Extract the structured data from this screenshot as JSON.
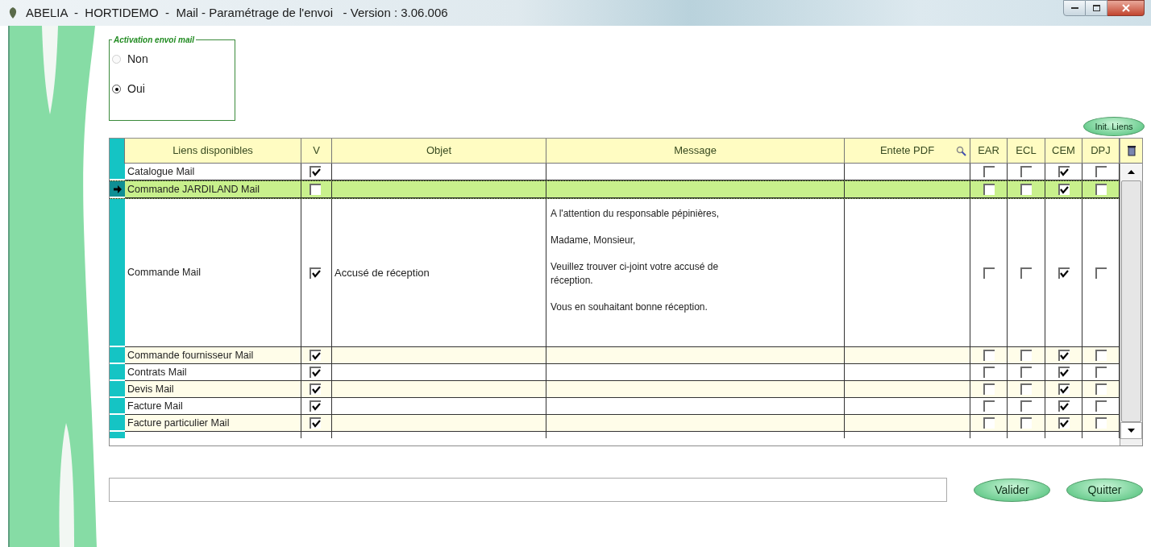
{
  "window": {
    "title": "ABELIA  -  HORTIDEMO  -  Mail - Paramétrage de l'envoi   - Version : 3.06.006"
  },
  "activation": {
    "legend": "Activation envoi mail",
    "options": [
      {
        "label": "Non",
        "selected": false
      },
      {
        "label": "Oui",
        "selected": true
      }
    ]
  },
  "init_button": "Init. Liens",
  "table": {
    "columns": [
      "Liens disponibles",
      "V",
      "Objet",
      "Message",
      "Entete PDF",
      "EAR",
      "ECL",
      "CEM",
      "DPJ"
    ],
    "rows": [
      {
        "link": "Catalogue Mail",
        "v": true,
        "objet": "",
        "message": [],
        "ear": false,
        "ecl": false,
        "cem": true,
        "dpj": false,
        "selected": false
      },
      {
        "link": "Commande JARDILAND Mail",
        "v": false,
        "objet": "",
        "message": [],
        "ear": false,
        "ecl": false,
        "cem": true,
        "dpj": false,
        "selected": true
      },
      {
        "link": "Commande Mail",
        "v": true,
        "objet": "Accusé de réception",
        "message": [
          "A l'attention du responsable pépinières,",
          "Madame, Monsieur,",
          "Veuillez trouver ci-joint votre accusé de réception.",
          "Vous en souhaitant bonne réception."
        ],
        "ear": false,
        "ecl": false,
        "cem": true,
        "dpj": false,
        "selected": false
      },
      {
        "link": "Commande fournisseur Mail",
        "v": true,
        "objet": "",
        "message": [],
        "ear": false,
        "ecl": false,
        "cem": true,
        "dpj": false,
        "selected": false
      },
      {
        "link": "Contrats Mail",
        "v": true,
        "objet": "",
        "message": [],
        "ear": false,
        "ecl": false,
        "cem": true,
        "dpj": false,
        "selected": false
      },
      {
        "link": "Devis Mail",
        "v": true,
        "objet": "",
        "message": [],
        "ear": false,
        "ecl": false,
        "cem": true,
        "dpj": false,
        "selected": false
      },
      {
        "link": "Facture Mail",
        "v": true,
        "objet": "",
        "message": [],
        "ear": false,
        "ecl": false,
        "cem": true,
        "dpj": false,
        "selected": false
      },
      {
        "link": "Facture particulier Mail",
        "v": true,
        "objet": "",
        "message": [],
        "ear": false,
        "ecl": false,
        "cem": true,
        "dpj": false,
        "selected": false
      }
    ]
  },
  "buttons": [
    "Valider",
    "Quitter"
  ]
}
